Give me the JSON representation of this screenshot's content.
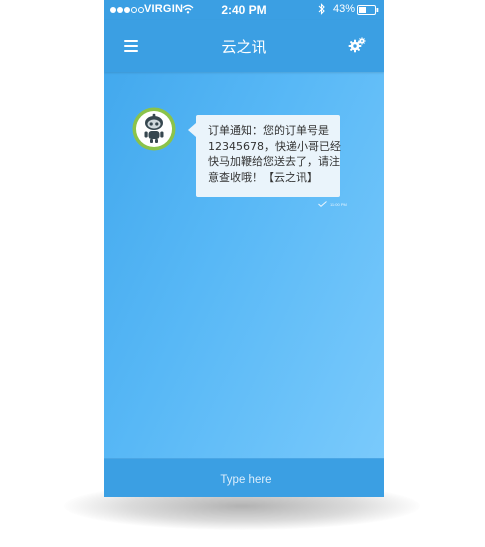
{
  "status_bar": {
    "carrier": "VIRGIN",
    "time": "2:40 PM",
    "battery": "43%",
    "signal_bars": 3
  },
  "nav": {
    "title": "云之讯",
    "menu_icon": "hamburger-menu-icon",
    "settings_icon": "gears-icon"
  },
  "messages": [
    {
      "sender_avatar": "robot-avatar",
      "text": "订单通知：您的订单号是\n12345678，快递小哥已经\n快马加鞭给您送去了，请注\n意查收哦！【云之讯】",
      "time": "11:00 PM",
      "status_icon": "checkmark-icon"
    }
  ],
  "input": {
    "placeholder": "Type here"
  },
  "colors": {
    "bar": "#3b9fe3",
    "background_start": "#3fa6ec",
    "background_end": "#7ccbfc",
    "bubble": "#eaf4fb",
    "avatar_ring": "#8bc34a"
  }
}
